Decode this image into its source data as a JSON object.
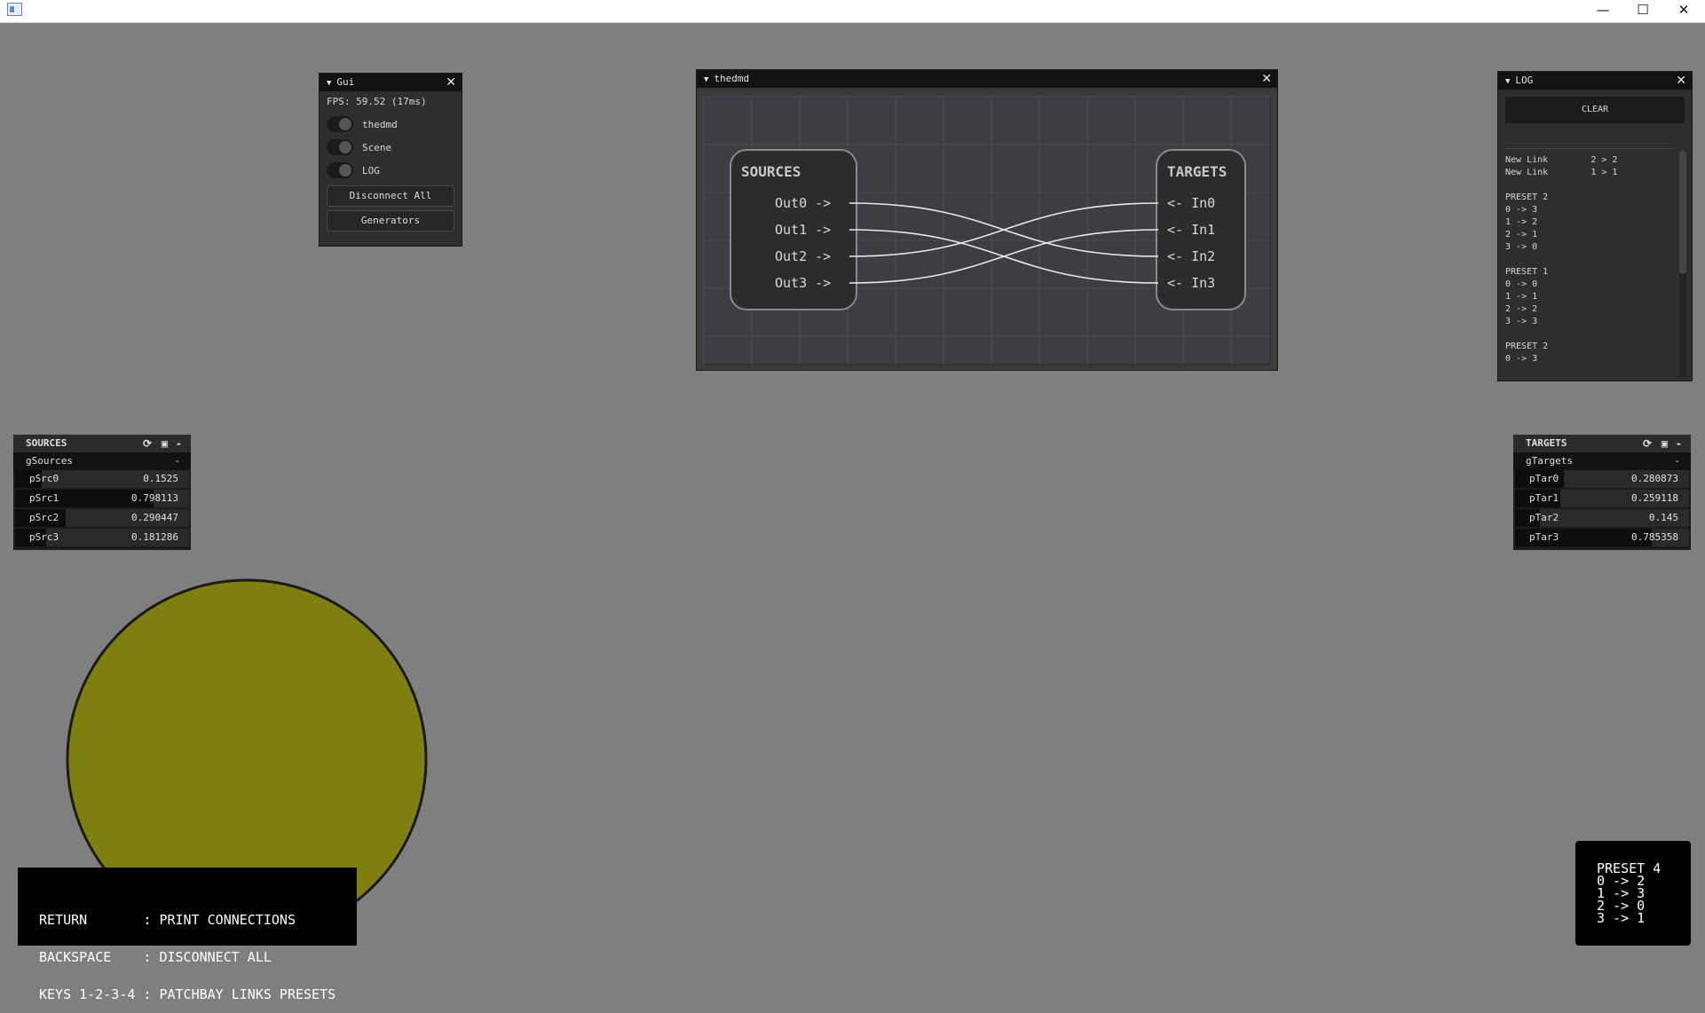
{
  "window": {
    "minimize": "—",
    "maximize": "☐",
    "close": "✕"
  },
  "gui": {
    "title": "Gui",
    "fps": "FPS: 59.52 (17ms)",
    "toggles": [
      "thedmd",
      "Scene",
      "LOG"
    ],
    "disconnect": "Disconnect All",
    "generators": "Generators"
  },
  "node": {
    "title": "thedmd",
    "sources_title": "SOURCES",
    "targets_title": "TARGETS",
    "outs": [
      "Out0 ->",
      "Out1 ->",
      "Out2 ->",
      "Out3 ->"
    ],
    "ins": [
      "<- In0",
      "<- In1",
      "<- In2",
      "<- In3"
    ],
    "links": [
      [
        0,
        2
      ],
      [
        1,
        3
      ],
      [
        2,
        0
      ],
      [
        3,
        1
      ]
    ]
  },
  "log": {
    "title": "LOG",
    "clear": "CLEAR",
    "lines": [
      "New Link        2 > 2",
      "New Link        1 > 1",
      "",
      "PRESET 2",
      "0 -> 3",
      "1 -> 2",
      "2 -> 1",
      "3 -> 0",
      "",
      "PRESET 1",
      "0 -> 0",
      "1 -> 1",
      "2 -> 2",
      "3 -> 3",
      "",
      "PRESET 2",
      "0 -> 3"
    ]
  },
  "sources": {
    "title": "SOURCES",
    "group": "gSources",
    "group_btn": "-",
    "collapse": "-",
    "params": [
      {
        "name": "pSrc0",
        "value": "0.1525",
        "level": 0.1525
      },
      {
        "name": "pSrc1",
        "value": "0.798113",
        "level": 0.798
      },
      {
        "name": "pSrc2",
        "value": "0.290447",
        "level": 0.29
      },
      {
        "name": "pSrc3",
        "value": "0.181286",
        "level": 0.181
      }
    ]
  },
  "targets": {
    "title": "TARGETS",
    "group": "gTargets",
    "group_btn": "-",
    "collapse": "-",
    "params": [
      {
        "name": "pTar0",
        "value": "0.280873",
        "level": 0.281
      },
      {
        "name": "pTar1",
        "value": "0.259118",
        "level": 0.259
      },
      {
        "name": "pTar2",
        "value": "0.145",
        "level": 0.145
      },
      {
        "name": "pTar3",
        "value": "0.785358",
        "level": 0.785
      }
    ]
  },
  "scene": {
    "circle_color": "#7f7f0f"
  },
  "hotkeys": [
    "RETURN       : PRINT CONNECTIONS",
    "BACKSPACE    : DISCONNECT ALL",
    "KEYS 1-2-3-4 : PATCHBAY LINKS PRESETS"
  ],
  "preset": [
    "PRESET 4",
    "0 -> 2",
    "1 -> 3",
    "2 -> 0",
    "3 -> 1"
  ]
}
